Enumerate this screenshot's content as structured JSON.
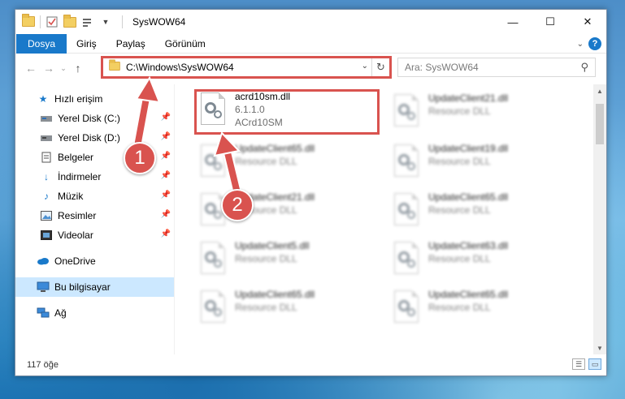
{
  "titlebar": {
    "title": "SysWOW64",
    "min_glyph": "—",
    "max_glyph": "☐",
    "close_glyph": "✕"
  },
  "ribbon": {
    "tabs": [
      "Dosya",
      "Giriş",
      "Paylaş",
      "Görünüm"
    ],
    "help_glyph": "?"
  },
  "address": {
    "path": "C:\\Windows\\SysWOW64",
    "search_placeholder": "Ara: SysWOW64"
  },
  "nav": {
    "items": [
      {
        "label": "Hızlı erişim",
        "icon": "star-icon"
      },
      {
        "label": "Yerel Disk (C:)",
        "icon": "drive-icon",
        "pinned": true
      },
      {
        "label": "Yerel Disk (D:)",
        "icon": "drive-icon",
        "pinned": true
      },
      {
        "label": "Belgeler",
        "icon": "documents-icon",
        "pinned": true
      },
      {
        "label": "İndirmeler",
        "icon": "download-icon",
        "pinned": true
      },
      {
        "label": "Müzik",
        "icon": "music-icon",
        "pinned": true
      },
      {
        "label": "Resimler",
        "icon": "pictures-icon",
        "pinned": true
      },
      {
        "label": "Videolar",
        "icon": "videos-icon",
        "pinned": true
      },
      {
        "label": "OneDrive",
        "icon": "onedrive-icon"
      },
      {
        "label": "Bu bilgisayar",
        "icon": "computer-icon",
        "selected": true
      },
      {
        "label": "Ağ",
        "icon": "network-icon"
      }
    ]
  },
  "files": [
    {
      "name": "acrd10sm.dll",
      "line2": "6.1.1.0",
      "line3": "ACrd10SM",
      "highlight": true
    },
    {
      "name": "UpdateClient21.dll",
      "line2": "Resource DLL"
    },
    {
      "name": "UpdateClient65.dll",
      "line2": "Resource DLL"
    },
    {
      "name": "UpdateClient19.dll",
      "line2": "Resource DLL"
    },
    {
      "name": "UpdateClient21.dll",
      "line2": "Resource DLL"
    },
    {
      "name": "UpdateClient65.dll",
      "line2": "Resource DLL"
    },
    {
      "name": "UpdateClient5.dll",
      "line2": "Resource DLL"
    },
    {
      "name": "UpdateClient63.dll",
      "line2": "Resource DLL"
    },
    {
      "name": "UpdateClient65.dll",
      "line2": "Resource DLL"
    },
    {
      "name": "UpdateClient65.dll",
      "line2": "Resource DLL"
    }
  ],
  "status": {
    "count": "117 öğe"
  },
  "annotations": {
    "badge1": "1",
    "badge2": "2",
    "color": "#d9534f"
  }
}
